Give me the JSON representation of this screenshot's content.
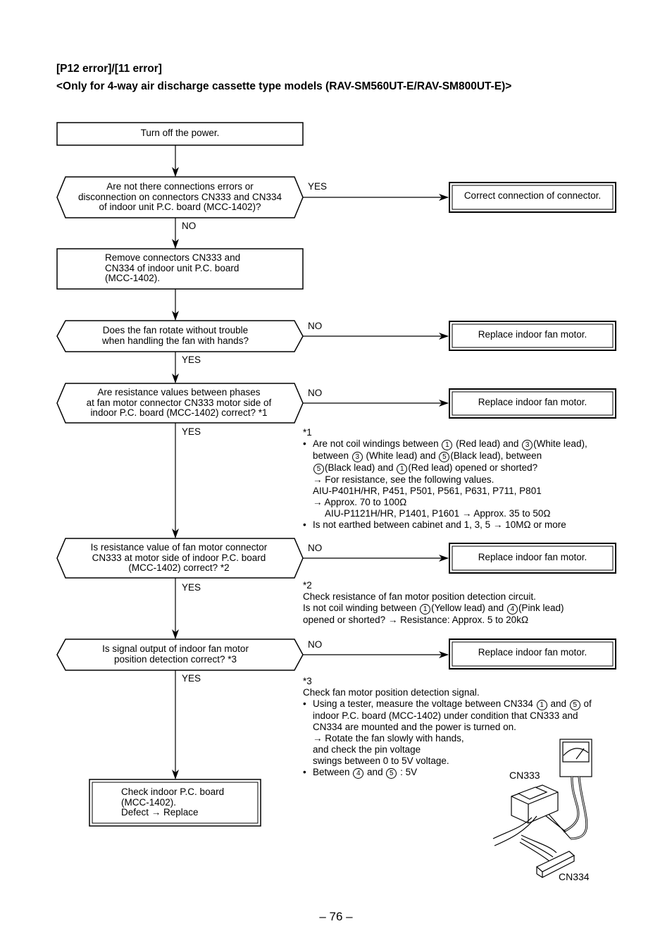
{
  "header": {
    "title": "[P12 error]/[11 error]",
    "subtitle": "<Only for 4-way air discharge cassette type models (RAV-SM560UT-E/RAV-SM800UT-E)>"
  },
  "flow": {
    "start": "Turn off the power.",
    "q1": {
      "lines": [
        "Are not there connections errors or",
        "disconnection on connectors CN333 and CN334",
        "of indoor unit P.C. board (MCC-1402)?"
      ],
      "yes_label": "YES",
      "no_label": "NO",
      "yes_action": "Correct connection of connector."
    },
    "step2": {
      "lines": [
        "Remove connectors CN333 and",
        "CN334 of indoor unit P.C. board",
        "(MCC-1402)."
      ]
    },
    "q2": {
      "lines": [
        "Does the fan rotate without trouble",
        "when handling the fan with hands?"
      ],
      "no_label": "NO",
      "yes_label": "YES",
      "no_action": "Replace indoor fan motor."
    },
    "q3": {
      "lines": [
        "Are resistance values between phases",
        "at fan motor connector CN333 motor side of",
        "indoor P.C. board (MCC-1402) correct? *1"
      ],
      "no_label": "NO",
      "yes_label": "YES",
      "no_action": "Replace indoor fan motor."
    },
    "q4": {
      "lines": [
        "Is resistance value of fan motor connector",
        "CN333 at motor side of indoor P.C. board",
        "(MCC-1402) correct? *2"
      ],
      "no_label": "NO",
      "yes_label": "YES",
      "no_action": "Replace indoor fan motor."
    },
    "q5": {
      "lines": [
        "Is signal output of indoor fan motor",
        "position detection correct? *3"
      ],
      "no_label": "NO",
      "yes_label": "YES",
      "no_action": "Replace indoor fan motor."
    },
    "end": {
      "lines": [
        "Check indoor P.C. board",
        "(MCC-1402).",
        "Defect → Replace"
      ]
    }
  },
  "notes": {
    "n1": {
      "marker": "*1",
      "b1_l1a": "Are not coil windings between ",
      "c1": "1",
      "b1_l1b": " (Red lead) and ",
      "c2": "3",
      "b1_l1c": "(White lead),",
      "b1_l2a": "between ",
      "c3": "3",
      "b1_l2b": " (White lead) and ",
      "c4": "5",
      "b1_l2c": "(Black lead), between",
      "c5": "5",
      "b1_l3a": "(Black lead) and ",
      "c6": "1",
      "b1_l3b": "(Red lead) opened or shorted?",
      "b1_l4": "→ For resistance, see the following values.",
      "b1_l5": "AIU-P401H/HR, P451, P501, P561, P631, P711, P801",
      "b1_l6": "→ Approx. 70 to 100Ω",
      "b1_l7": "AIU-P1121H/HR, P1401, P1601 → Approx. 35 to 50Ω",
      "b2": "Is not earthed between cabinet and 1, 3, 5 → 10MΩ or more"
    },
    "n2": {
      "marker": "*2",
      "l1": "Check resistance of fan motor position detection circuit.",
      "l2a": "Is not coil winding between ",
      "c1": "1",
      "l2b": "(Yellow lead) and ",
      "c2": "4",
      "l2c": "(Pink lead)",
      "l3": "opened or shorted? → Resistance: Approx. 5 to 20kΩ"
    },
    "n3": {
      "marker": "*3",
      "l1": "Check fan motor position detection signal.",
      "b1_l1a": "Using a tester, measure the voltage between CN334 ",
      "c1": "1",
      "b1_l1b": " and ",
      "c2": "5",
      "b1_l1c": " of",
      "b1_l2": "indoor P.C. board (MCC-1402) under condition that CN333 and",
      "b1_l3": "CN334 are mounted and the power is turned on.",
      "b1_l4": "→ Rotate the fan slowly with hands,",
      "b1_l5": "and check the pin voltage",
      "b1_l6": "swings between 0 to 5V voltage.",
      "b2a": "Between ",
      "c3": "4",
      "b2b": " and ",
      "c4": "5",
      "b2c": " : 5V"
    }
  },
  "illustration": {
    "label_cn333": "CN333",
    "label_cn334": "CN334"
  },
  "footer": {
    "page_number": "– 76 –"
  }
}
